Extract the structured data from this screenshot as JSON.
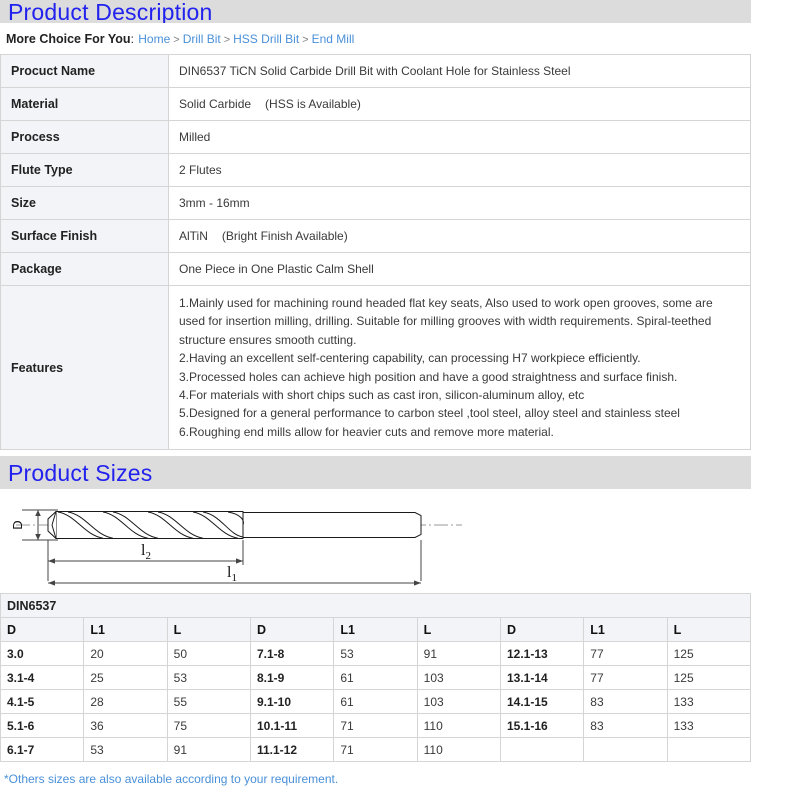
{
  "sections": {
    "description_title": "Product Description",
    "sizes_title": "Product Sizes"
  },
  "breadcrumb": {
    "label": "More Choice For You",
    "colon": ":",
    "separator": ">",
    "items": [
      {
        "label": "Home"
      },
      {
        "label": "Drill Bit"
      },
      {
        "label": "HSS Drill Bit"
      },
      {
        "label": "End Mill"
      }
    ]
  },
  "spec_table": {
    "rows": [
      {
        "key": "Procuct Name",
        "value": "DIN6537 TiCN Solid Carbide Drill Bit with Coolant Hole for Stainless Steel",
        "note": ""
      },
      {
        "key": "Material",
        "value": "Solid Carbide",
        "note": "(HSS is Available)"
      },
      {
        "key": "Process",
        "value": "Milled",
        "note": ""
      },
      {
        "key": "Flute Type",
        "value": "2 Flutes",
        "note": ""
      },
      {
        "key": "Size",
        "value": "3mm - 16mm",
        "note": ""
      },
      {
        "key": "Surface Finish",
        "value": "AlTiN",
        "note": "(Bright Finish Available)"
      },
      {
        "key": "Package",
        "value": "One Piece in One Plastic Calm Shell",
        "note": ""
      }
    ],
    "features_key": "Features",
    "features": [
      "1.Mainly used for machining round headed flat key seats, Also used to work open grooves, some are used for insertion milling, drilling. Suitable for milling grooves with width requirements. Spiral-teethed structure ensures smooth cutting.",
      "2.Having an excellent self-centering capability, can processing H7 workpiece efficiently.",
      "3.Processed holes can achieve high position and have a good straightness and surface finish.",
      "4.For materials with short chips such as cast iron, silicon-aluminum alloy, etc",
      "5.Designed for a general performance to carbon steel ,tool steel, alloy steel and stainless steel",
      "6.Roughing end mills allow for heavier cuts and remove more material."
    ]
  },
  "drawing": {
    "diameter_label": "D",
    "flute_length_label": "l",
    "flute_length_sub": "2",
    "total_length_label": "l",
    "total_length_sub": "1"
  },
  "sizes_table": {
    "title": "DIN6537",
    "headers": [
      "D",
      "L1",
      "L",
      "D",
      "L1",
      "L",
      "D",
      "L1",
      "L"
    ],
    "rows": [
      [
        "3.0",
        "20",
        "50",
        "7.1-8",
        "53",
        "91",
        "12.1-13",
        "77",
        "125"
      ],
      [
        "3.1-4",
        "25",
        "53",
        "8.1-9",
        "61",
        "103",
        "13.1-14",
        "77",
        "125"
      ],
      [
        "4.1-5",
        "28",
        "55",
        "9.1-10",
        "61",
        "103",
        "14.1-15",
        "83",
        "133"
      ],
      [
        "5.1-6",
        "36",
        "75",
        "10.1-11",
        "71",
        "110",
        "15.1-16",
        "83",
        "133"
      ],
      [
        "6.1-7",
        "53",
        "91",
        "11.1-12",
        "71",
        "110",
        "",
        "",
        ""
      ]
    ]
  },
  "footnote": "*Others sizes are also available according to your requirement.",
  "colors": {
    "section_bar_bg": "#dcdcdc",
    "section_title": "#2222ee",
    "link": "#4a90d9",
    "table_header_bg": "#f2f4f8",
    "border": "#d5d5d5"
  }
}
